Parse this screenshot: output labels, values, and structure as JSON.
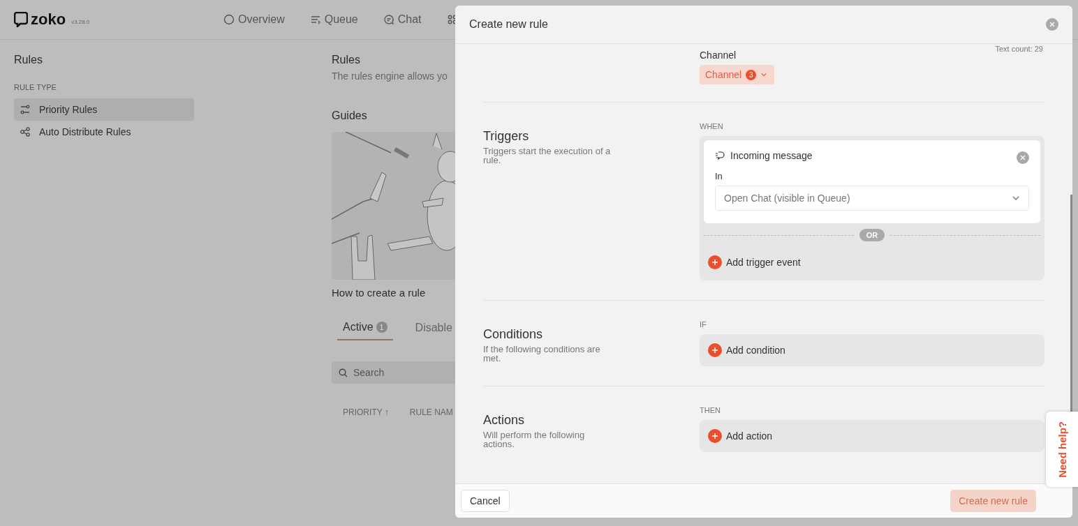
{
  "app": {
    "logo": "zoko",
    "version": "v3.28.0",
    "nav": [
      {
        "kind": "circle",
        "label": "Overview"
      },
      {
        "kind": "queue",
        "label": "Queue"
      },
      {
        "kind": "chat",
        "label": "Chat"
      },
      {
        "kind": "apps"
      }
    ]
  },
  "sidebar": {
    "title": "Rules",
    "section": "RULE TYPE",
    "items": [
      {
        "kind": "priority",
        "label": "Priority Rules",
        "selected": true
      },
      {
        "kind": "distribute",
        "label": "Auto Distribute Rules",
        "selected": false
      }
    ]
  },
  "main": {
    "title": "Rules",
    "description": "The rules engine allows yo",
    "guides_title": "Guides",
    "guide": {
      "kind": "picture",
      "caption": "How to create a rule"
    },
    "tabs": [
      {
        "label": "Active",
        "count": "1",
        "selected": true
      },
      {
        "label": "Disable",
        "selected": false
      }
    ],
    "search": {
      "placeholder": "Search"
    },
    "columns": [
      "PRIORITY ↑",
      "RULE NAM"
    ]
  },
  "modal": {
    "title": "Create new rule",
    "text_count": "Text count: 29",
    "channel": {
      "label": "Channel",
      "value": "Channel",
      "count": "3"
    },
    "sections": [
      {
        "kind": "triggers",
        "title": "Triggers",
        "description": "Triggers start the execution of a rule.",
        "keyword": "WHEN",
        "triggers": [
          {
            "title": "Incoming message",
            "field_label": "In",
            "value": "Open Chat (visible in Queue)"
          }
        ],
        "separator": "OR",
        "add": "Add trigger event"
      },
      {
        "kind": "simple",
        "title": "Conditions",
        "description": "If the following conditions are met.",
        "keyword": "IF",
        "add": "Add condition"
      },
      {
        "kind": "simple",
        "title": "Actions",
        "description": "Will perform the following actions.",
        "keyword": "THEN",
        "add": "Add action"
      }
    ],
    "cancel": "Cancel",
    "create": {
      "label": "Create new rule",
      "disabled": true
    }
  },
  "help_tab": "Need help?"
}
